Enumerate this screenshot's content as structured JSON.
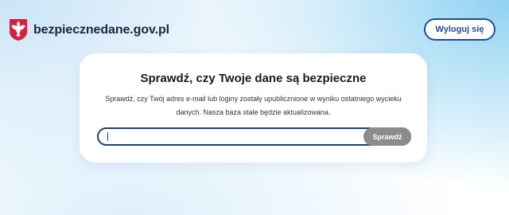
{
  "header": {
    "site_name": "bezpiecznedane.gov.pl",
    "logo_icon": "polish-eagle-emblem",
    "logout_label": "Wyloguj się"
  },
  "check": {
    "title": "Sprawdź, czy Twoje dane są bezpieczne",
    "description": "Sprawdź, czy Twój adres e-mail lub loginy zostały upublicznione w wyniku ostatniego wycieku danych. Nasza baza stale będzie aktualizowana.",
    "input_value": "",
    "input_placeholder": "",
    "submit_label": "Sprawdź"
  },
  "colors": {
    "accent_blue": "#1f4c9a",
    "input_border": "#1f3f74",
    "button_grey": "#8c8c8c",
    "emblem_red": "#d4213d"
  }
}
